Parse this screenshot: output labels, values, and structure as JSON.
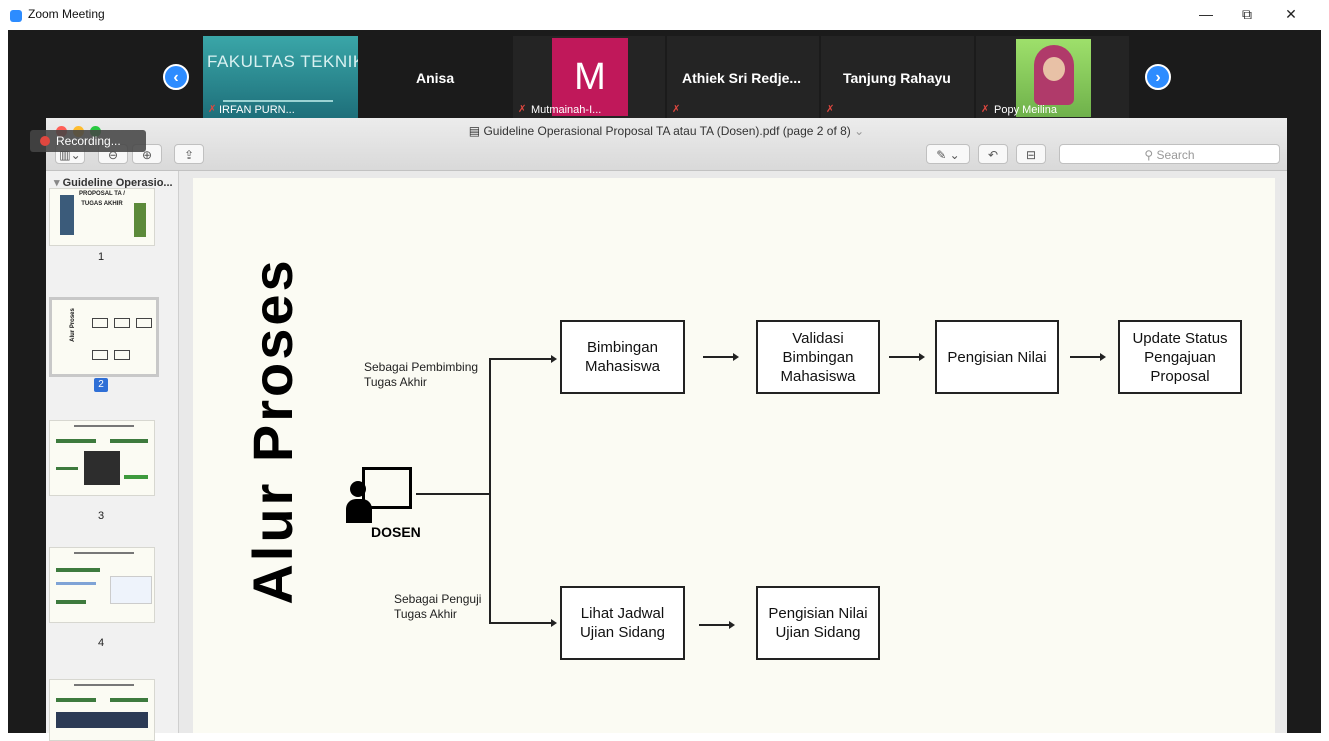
{
  "window": {
    "title": "Zoom Meeting",
    "minimize": "—",
    "restore": "⧉",
    "close": "✕"
  },
  "participants": [
    {
      "name": "IRFAN PURN...",
      "banner": "FAKULTAS TEKNIK"
    },
    {
      "name": "Anisa"
    },
    {
      "name": "Mutmainah-I...",
      "initial": "M"
    },
    {
      "name": "Athiek Sri Redje..."
    },
    {
      "name": "Tanjung Rahayu"
    },
    {
      "name": "Popy Meilina"
    }
  ],
  "nav": {
    "prev": "‹",
    "next": "›"
  },
  "recording": "Recording...",
  "preview": {
    "title": "Guideline Operasional Proposal TA atau TA (Dosen).pdf (page 2 of 8)",
    "search_placeholder": "Search",
    "sidebar_header": "Guideline Operasio...",
    "pages": [
      "1",
      "2",
      "3",
      "4"
    ]
  },
  "slide": {
    "title": "Alur Proses",
    "actor": "DOSEN",
    "branch_top": "Sebagai Pembimbing\nTugas Akhir",
    "branch_bottom": "Sebagai Penguji\nTugas Akhir",
    "flow_top": [
      "Bimbingan\nMahasiswa",
      "Validasi\nBimbingan\nMahasiswa",
      "Pengisian Nilai",
      "Update Status\nPengajuan\nProposal"
    ],
    "flow_bottom": [
      "Lihat Jadwal\nUjian Sidang",
      "Pengisian Nilai\nUjian Sidang"
    ]
  },
  "thumb1": {
    "line1": "PROPOSAL TA /",
    "line2": "TUGAS AKHIR"
  },
  "colors": {
    "zoom_blue": "#2d8cff",
    "mutmainah_tile": "#c0185a",
    "mic_muted": "#e0473f"
  }
}
